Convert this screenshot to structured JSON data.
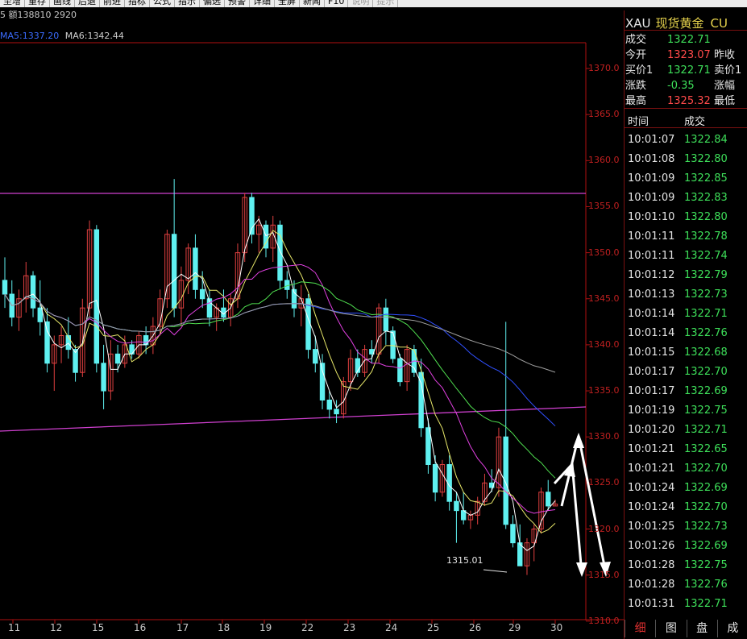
{
  "toolbar": {
    "items": [
      "至增",
      "重存",
      "画线",
      "后退",
      "前进",
      "指标",
      "公式",
      "指示",
      "偏选",
      "预警",
      "详细",
      "全屏",
      "新闻",
      "F10",
      "说明",
      "提示"
    ]
  },
  "info": {
    "text": "5 额138810 2920"
  },
  "ma": {
    "ma5": "MA5:1337.20",
    "ma6": "MA6:1342.44"
  },
  "quote": {
    "symbol": "XAU",
    "name": "现货黄金",
    "currency": "CU",
    "rows": [
      {
        "label": "成交",
        "value": "1322.71",
        "value_color": "#3ee05a",
        "label2": ""
      },
      {
        "label": "今开",
        "value": "1323.07",
        "value_color": "#ff4a4a",
        "label2": "昨收"
      },
      {
        "label": "买价1",
        "value": "1322.71",
        "value_color": "#3ee05a",
        "label2": "卖价1"
      },
      {
        "label": "涨跌",
        "value": "-0.35",
        "value_color": "#3ee05a",
        "label2": "涨幅"
      },
      {
        "label": "最高",
        "value": "1325.32",
        "value_color": "#ff4a4a",
        "label2": "最低"
      }
    ]
  },
  "ticks": {
    "headers": [
      "时间",
      "成交"
    ],
    "rows": [
      {
        "time": "10:01:07",
        "price": "1322.84"
      },
      {
        "time": "10:01:08",
        "price": "1322.80"
      },
      {
        "time": "10:01:09",
        "price": "1322.85"
      },
      {
        "time": "10:01:09",
        "price": "1322.83"
      },
      {
        "time": "10:01:10",
        "price": "1322.80"
      },
      {
        "time": "10:01:11",
        "price": "1322.78"
      },
      {
        "time": "10:01:11",
        "price": "1322.74"
      },
      {
        "time": "10:01:12",
        "price": "1322.79"
      },
      {
        "time": "10:01:13",
        "price": "1322.73"
      },
      {
        "time": "10:01:14",
        "price": "1322.71"
      },
      {
        "time": "10:01:14",
        "price": "1322.76"
      },
      {
        "time": "10:01:15",
        "price": "1322.68"
      },
      {
        "time": "10:01:17",
        "price": "1322.70"
      },
      {
        "time": "10:01:17",
        "price": "1322.69"
      },
      {
        "time": "10:01:19",
        "price": "1322.75"
      },
      {
        "time": "10:01:20",
        "price": "1322.71"
      },
      {
        "time": "10:01:21",
        "price": "1322.65"
      },
      {
        "time": "10:01:21",
        "price": "1322.70"
      },
      {
        "time": "10:01:24",
        "price": "1322.69"
      },
      {
        "time": "10:01:24",
        "price": "1322.70"
      },
      {
        "time": "10:01:25",
        "price": "1322.73"
      },
      {
        "time": "10:01:26",
        "price": "1322.69"
      },
      {
        "time": "10:01:28",
        "price": "1322.75"
      },
      {
        "time": "10:01:28",
        "price": "1322.76"
      },
      {
        "time": "10:01:31",
        "price": "1322.71"
      }
    ]
  },
  "tabs": [
    "细",
    "图",
    "盘",
    "成"
  ],
  "chart_data": {
    "type": "candlestick",
    "y_ticks": [
      "1370.0",
      "1365.0",
      "1360.0",
      "1355.0",
      "1350.0",
      "1345.0",
      "1340.0",
      "1335.0",
      "1330.0",
      "1325.0",
      "1320.0",
      "1315.0",
      "1310.0"
    ],
    "ylim": [
      1310,
      1372
    ],
    "x_ticks": [
      "11",
      "12",
      "15",
      "16",
      "17",
      "18",
      "19",
      "22",
      "23",
      "24",
      "25",
      "26",
      "29",
      "30"
    ],
    "low_annotation": "1315.01",
    "ohlc": [
      [
        1347.0,
        1349.5,
        1344.0,
        1345.5
      ],
      [
        1345.5,
        1347.0,
        1342.0,
        1343.0
      ],
      [
        1343.0,
        1346.0,
        1341.5,
        1345.0
      ],
      [
        1345.0,
        1349.0,
        1343.5,
        1347.5
      ],
      [
        1347.5,
        1348.0,
        1343.0,
        1344.0
      ],
      [
        1344.0,
        1347.0,
        1341.0,
        1342.5
      ],
      [
        1342.5,
        1344.0,
        1337.0,
        1338.0
      ],
      [
        1338.0,
        1341.0,
        1335.0,
        1340.0
      ],
      [
        1340.0,
        1342.0,
        1338.0,
        1341.0
      ],
      [
        1341.0,
        1343.0,
        1338.5,
        1339.5
      ],
      [
        1339.5,
        1340.0,
        1336.0,
        1337.0
      ],
      [
        1337.0,
        1345.0,
        1336.5,
        1344.0
      ],
      [
        1344.0,
        1353.5,
        1343.0,
        1352.5
      ],
      [
        1352.5,
        1353.0,
        1337.0,
        1338.0
      ],
      [
        1338.0,
        1340.0,
        1333.0,
        1335.0
      ],
      [
        1335.0,
        1340.5,
        1334.0,
        1339.0
      ],
      [
        1339.0,
        1340.0,
        1337.0,
        1338.0
      ],
      [
        1338.0,
        1341.0,
        1337.5,
        1340.0
      ],
      [
        1340.0,
        1340.5,
        1338.5,
        1339.0
      ],
      [
        1339.0,
        1341.5,
        1338.5,
        1341.0
      ],
      [
        1341.0,
        1342.0,
        1339.0,
        1340.0
      ],
      [
        1340.0,
        1343.0,
        1339.0,
        1342.0
      ],
      [
        1342.0,
        1346.0,
        1341.0,
        1345.0
      ],
      [
        1345.0,
        1352.5,
        1344.0,
        1352.0
      ],
      [
        1352.0,
        1358.0,
        1343.0,
        1344.0
      ],
      [
        1344.0,
        1348.5,
        1342.0,
        1347.0
      ],
      [
        1347.0,
        1351.0,
        1345.5,
        1350.5
      ],
      [
        1350.5,
        1352.0,
        1345.0,
        1346.0
      ],
      [
        1346.0,
        1348.0,
        1344.0,
        1345.0
      ],
      [
        1345.0,
        1346.0,
        1342.0,
        1343.0
      ],
      [
        1343.0,
        1344.5,
        1341.5,
        1344.0
      ],
      [
        1344.0,
        1346.0,
        1342.5,
        1343.0
      ],
      [
        1343.0,
        1345.5,
        1342.0,
        1345.0
      ],
      [
        1345.0,
        1351.0,
        1344.0,
        1350.0
      ],
      [
        1350.0,
        1356.5,
        1349.0,
        1356.0
      ],
      [
        1356.0,
        1356.5,
        1351.0,
        1352.0
      ],
      [
        1352.0,
        1354.0,
        1350.0,
        1353.0
      ],
      [
        1353.0,
        1353.5,
        1349.5,
        1350.5
      ],
      [
        1350.5,
        1354.0,
        1349.0,
        1353.0
      ],
      [
        1353.0,
        1353.5,
        1346.0,
        1347.0
      ],
      [
        1347.0,
        1348.0,
        1345.0,
        1346.0
      ],
      [
        1346.0,
        1347.0,
        1343.0,
        1344.0
      ],
      [
        1344.0,
        1346.5,
        1342.0,
        1345.0
      ],
      [
        1345.0,
        1345.5,
        1338.5,
        1339.5
      ],
      [
        1339.5,
        1341.0,
        1337.0,
        1338.0
      ],
      [
        1338.0,
        1339.0,
        1333.0,
        1334.0
      ],
      [
        1334.0,
        1335.0,
        1332.0,
        1333.0
      ],
      [
        1333.0,
        1334.0,
        1331.5,
        1332.5
      ],
      [
        1332.5,
        1336.5,
        1332.0,
        1336.0
      ],
      [
        1336.0,
        1339.5,
        1335.0,
        1338.5
      ],
      [
        1338.5,
        1339.5,
        1336.5,
        1337.0
      ],
      [
        1337.0,
        1340.0,
        1336.5,
        1339.5
      ],
      [
        1339.5,
        1340.5,
        1338.0,
        1339.0
      ],
      [
        1339.0,
        1344.5,
        1338.0,
        1344.0
      ],
      [
        1344.0,
        1345.0,
        1340.0,
        1341.5
      ],
      [
        1341.5,
        1342.0,
        1338.0,
        1338.5
      ],
      [
        1338.5,
        1339.0,
        1335.5,
        1336.0
      ],
      [
        1336.0,
        1340.0,
        1335.0,
        1339.5
      ],
      [
        1339.5,
        1340.0,
        1336.5,
        1337.0
      ],
      [
        1337.0,
        1338.5,
        1330.0,
        1331.0
      ],
      [
        1331.0,
        1332.0,
        1326.0,
        1327.0
      ],
      [
        1327.0,
        1328.0,
        1323.0,
        1324.0
      ],
      [
        1324.0,
        1327.5,
        1323.5,
        1327.0
      ],
      [
        1327.0,
        1328.0,
        1322.0,
        1323.0
      ],
      [
        1323.0,
        1324.0,
        1318.5,
        1322.0
      ],
      [
        1322.0,
        1324.0,
        1320.5,
        1321.0
      ],
      [
        1321.0,
        1322.0,
        1320.0,
        1321.5
      ],
      [
        1321.5,
        1323.5,
        1320.5,
        1323.0
      ],
      [
        1323.0,
        1326.0,
        1322.5,
        1325.0
      ],
      [
        1325.0,
        1326.5,
        1324.0,
        1324.5
      ],
      [
        1324.5,
        1331.0,
        1323.5,
        1330.0
      ],
      [
        1330.0,
        1342.5,
        1320.0,
        1320.5
      ],
      [
        1320.5,
        1321.5,
        1318.0,
        1318.5
      ],
      [
        1318.5,
        1320.5,
        1316.0,
        1316.0
      ],
      [
        1316.0,
        1319.0,
        1315.01,
        1318.5
      ],
      [
        1318.5,
        1320.5,
        1316.5,
        1320.0
      ],
      [
        1320.0,
        1324.5,
        1319.5,
        1324.0
      ],
      [
        1324.0,
        1325.32,
        1322.0,
        1322.5
      ],
      [
        1322.5,
        1323.2,
        1322.5,
        1322.71
      ]
    ]
  }
}
